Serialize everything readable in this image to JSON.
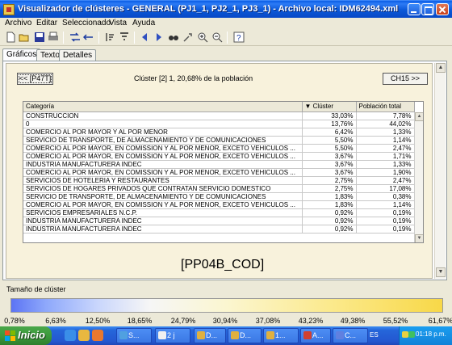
{
  "window": {
    "title": "Visualizador de clústeres - GENERAL (PJ1_1, PJ2_1, PJ3_1) - Archivo local: IDM62494.xml"
  },
  "menu": [
    "Archivo",
    "Editar",
    "Seleccionado",
    "Vista",
    "Ayuda"
  ],
  "toolbar": [
    "new-icon",
    "open-icon",
    "save-icon",
    "print-icon",
    "shuffle-icon",
    "swap-icon",
    "sort-icon",
    "filter-icon",
    "prev-icon",
    "next-icon",
    "find-icon",
    "drill-icon",
    "zoom-in-icon",
    "zoom-out-icon",
    "help-icon"
  ],
  "tabs": [
    "Gráficos",
    "Texto",
    "Detalles"
  ],
  "nav": {
    "prev_label": "<< [P47T]",
    "next_label": "CH15 >>"
  },
  "cluster": {
    "title": "Clúster [2] 1, 20,68% de la población"
  },
  "grid": {
    "headers": {
      "category": "Categoría",
      "cluster": "Clúster",
      "population": "Población total",
      "sort_glyph": "▼"
    },
    "rows": [
      {
        "category": "CONSTRUCCION",
        "cluster": "33,03%",
        "population": "7,78%"
      },
      {
        "category": "0",
        "cluster": "13,76%",
        "population": "44,02%"
      },
      {
        "category": "COMERCIO AL POR MAYOR Y AL POR MENOR",
        "cluster": "6,42%",
        "population": "1,33%"
      },
      {
        "category": "SERVICIO DE TRANSPORTE, DE ALMACENAMIENTO Y DE COMUNICACIONES",
        "cluster": "5,50%",
        "population": "1,14%"
      },
      {
        "category": "COMERCIO AL POR MAYOR, EN COMISSION Y AL POR MENOR, EXCETO VEHICULOS ...",
        "cluster": "5,50%",
        "population": "2,47%"
      },
      {
        "category": "COMERCIO AL POR MAYOR, EN COMISSION Y AL POR MENOR, EXCETO VEHICULOS ...",
        "cluster": "3,67%",
        "population": "1,71%"
      },
      {
        "category": "INDUSTRIA MANUFACTURERA INDEC",
        "cluster": "3,67%",
        "population": "1,33%"
      },
      {
        "category": "COMERCIO AL POR MAYOR, EN COMISSION Y AL POR MENOR, EXCETO VEHICULOS ...",
        "cluster": "3,67%",
        "population": "1,90%"
      },
      {
        "category": "SERVICIOS DE HOTELERIA Y RESTAURANTES",
        "cluster": "2,75%",
        "population": "2,47%"
      },
      {
        "category": "SERVICIOS DE HOGARES PRIVADOS QUE CONTRATAN SERVICIO DOMESTICO",
        "cluster": "2,75%",
        "population": "17,08%"
      },
      {
        "category": "SERVICIO DE TRANSPORTE, DE ALMACENAMIENTO Y DE COMUNICACIONES",
        "cluster": "1,83%",
        "population": "0,38%"
      },
      {
        "category": "COMERCIO AL POR MAYOR, EN COMISSION Y AL POR MENOR, EXCETO VEHICULOS ...",
        "cluster": "1,83%",
        "population": "1,14%"
      },
      {
        "category": "SERVICIOS EMPRESARIALES N.C.P.",
        "cluster": "0,92%",
        "population": "0,19%"
      },
      {
        "category": "INDUSTRIA MANUFACTURERA INDEC",
        "cluster": "0,92%",
        "population": "0,19%"
      },
      {
        "category": "INDUSTRIA MANUFACTURERA INDEC",
        "cluster": "0,92%",
        "population": "0,19%"
      }
    ]
  },
  "variable_label": "[PP04B_COD]",
  "legend": {
    "title": "Tamaño de clúster",
    "colors": [
      "#5c74f4",
      "#f6f6f6",
      "#f8d848"
    ],
    "ticks": [
      "0,78%",
      "6,63%",
      "12,50%",
      "18,65%",
      "24,79%",
      "30,94%",
      "37,08%",
      "43,23%",
      "49,38%",
      "55,52%",
      "61,67%"
    ]
  },
  "taskbar": {
    "start_label": "Inicio",
    "tasks": [
      "S...",
      "2 j",
      "D...",
      "D...",
      "1...",
      "A...",
      "C..."
    ],
    "lang": "ES",
    "clock": "01:18 p.m."
  }
}
